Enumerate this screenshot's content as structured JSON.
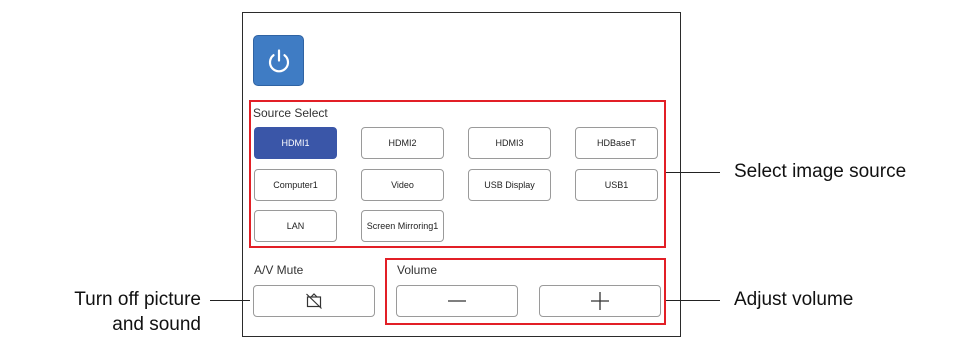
{
  "source_select": {
    "label": "Source Select",
    "selected": "HDMI1",
    "sources": [
      "HDMI1",
      "HDMI2",
      "HDMI3",
      "HDBaseT",
      "Computer1",
      "Video",
      "USB Display",
      "USB1",
      "LAN",
      "Screen Mirroring1"
    ]
  },
  "av_mute": {
    "label": "A/V Mute"
  },
  "volume": {
    "label": "Volume"
  },
  "callouts": {
    "source": "Select image source",
    "volume": "Adjust volume",
    "mute_line1": "Turn off picture",
    "mute_line2": "and sound"
  },
  "colors": {
    "power": "#3f7cc4",
    "selected_source": "#3a56a8",
    "highlight": "#e21f26"
  },
  "icons": {
    "power": "power-icon",
    "mute": "av-mute-icon",
    "minus": "minus-icon",
    "plus": "plus-icon"
  }
}
